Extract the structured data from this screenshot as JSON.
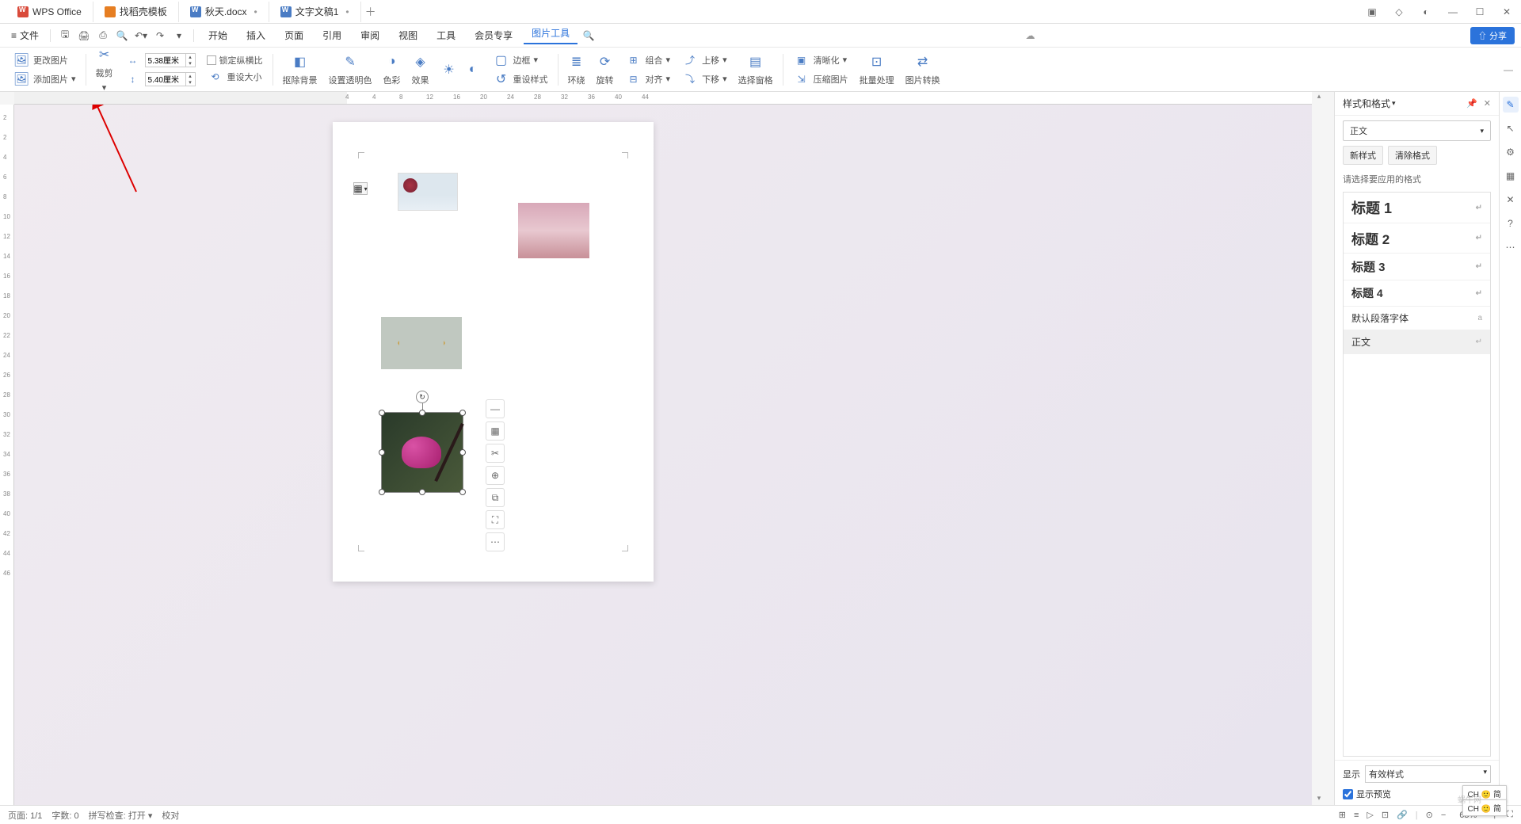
{
  "titlebar": {
    "app_name": "WPS Office",
    "tabs": [
      {
        "label": "找稻壳模板",
        "icon": "orange"
      },
      {
        "label": "秋天.docx",
        "icon": "blue",
        "dirty": true
      },
      {
        "label": "文字文稿1",
        "icon": "blue",
        "dirty": true
      }
    ]
  },
  "menubar": {
    "file_label": "文件",
    "items": [
      "开始",
      "插入",
      "页面",
      "引用",
      "审阅",
      "视图",
      "工具",
      "会员专享",
      "图片工具"
    ],
    "active_index": 8,
    "share_label": "⇧ 分享"
  },
  "ribbon": {
    "change_pic": "更改图片",
    "add_pic": "添加图片",
    "crop": "裁剪",
    "width_value": "5.38厘米",
    "height_value": "5.40厘米",
    "lock_ratio": "锁定纵横比",
    "reset_size": "重设大小",
    "remove_bg": "抠除背景",
    "set_transparency": "设置透明色",
    "colorize": "色彩",
    "effects": "效果",
    "border": "边框",
    "reset_style": "重设样式",
    "wrap": "环绕",
    "rotate": "旋转",
    "group": "组合",
    "align": "对齐",
    "move_up": "上移",
    "move_down": "下移",
    "selection_pane": "选择窗格",
    "sharpen": "清晰化",
    "compress": "压缩图片",
    "batch": "批量处理",
    "convert": "图片转换"
  },
  "ruler_h": [
    "4",
    "4",
    "8",
    "12",
    "16",
    "20",
    "24",
    "28",
    "32",
    "36",
    "40",
    "44"
  ],
  "ruler_v": [
    "2",
    "2",
    "4",
    "6",
    "8",
    "10",
    "12",
    "14",
    "16",
    "18",
    "20",
    "22",
    "24",
    "26",
    "28",
    "30",
    "32",
    "34",
    "36",
    "38",
    "40",
    "42",
    "44",
    "46"
  ],
  "style_panel": {
    "title": "样式和格式",
    "current_style": "正文",
    "new_style": "新样式",
    "clear_format": "清除格式",
    "apply_label": "请选择要应用的格式",
    "styles": [
      {
        "name": "标题 1",
        "cls": "h1",
        "mark": "↵"
      },
      {
        "name": "标题 2",
        "cls": "h2",
        "mark": "↵"
      },
      {
        "name": "标题 3",
        "cls": "h3",
        "mark": "↵"
      },
      {
        "name": "标题 4",
        "cls": "h4",
        "mark": "↵"
      },
      {
        "name": "默认段落字体",
        "cls": "",
        "mark": "a"
      },
      {
        "name": "正文",
        "cls": "selected",
        "mark": "↵"
      }
    ],
    "show_label": "显示",
    "show_value": "有效样式",
    "preview_label": "显示预览"
  },
  "statusbar": {
    "page": "页面: 1/1",
    "words": "字数: 0",
    "spell": "拼写检查: 打开",
    "proof": "校对",
    "zoom": "65%"
  },
  "ime": "CH 🙂 简",
  "watermark": "蜗牛网"
}
